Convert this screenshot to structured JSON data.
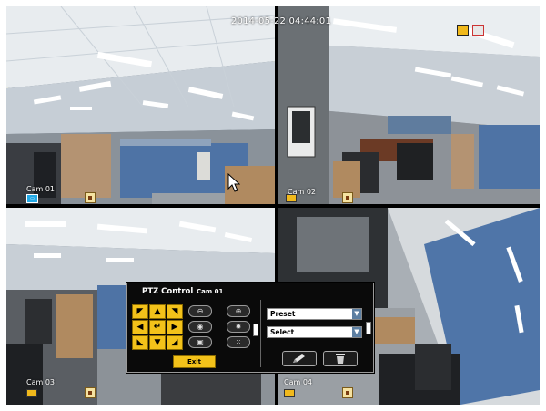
{
  "timestamp": "2014-05-22 04:44:01",
  "cameras": [
    {
      "label": "Cam 01"
    },
    {
      "label": "Cam 02"
    },
    {
      "label": "Cam 03"
    },
    {
      "label": "Cam 04"
    }
  ],
  "ptz": {
    "title": "PTZ Control",
    "camera": "Cam 01",
    "exit_label": "Exit",
    "preset_label": "Preset",
    "select_label": "Select",
    "arrows": {
      "up_left": "◤",
      "up": "▲",
      "up_right": "◥",
      "left": "◀",
      "center": "↵",
      "right": "▶",
      "down_left": "◣",
      "down": "▼",
      "down_right": "◢"
    },
    "zoom": {
      "zoom_out": "⊖",
      "zoom_in": "⊕",
      "focus_near": "◉",
      "focus_far": "✹",
      "iris_open": "▣",
      "iris_close": "⁙"
    }
  },
  "colors": {
    "accent": "#f3c21a",
    "selected_border": "#e8d64a"
  }
}
